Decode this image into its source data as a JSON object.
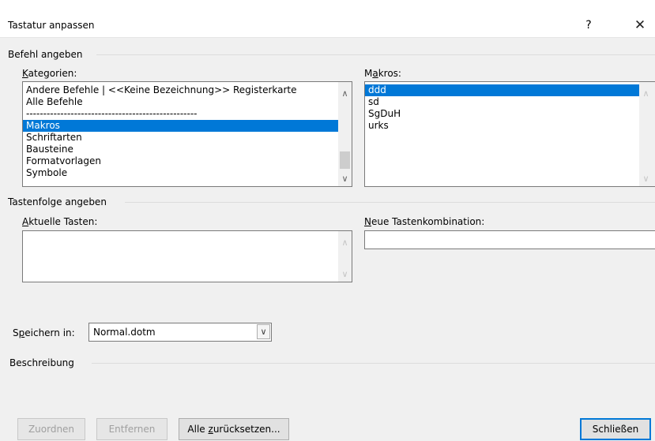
{
  "dialog": {
    "title": "Tastatur anpassen",
    "help_label": "?",
    "close_label": "✕"
  },
  "command_section": {
    "title": "Befehl angeben",
    "categories_label_k": "K",
    "categories_label_rest": "ategorien:",
    "categories": [
      {
        "label": "Andere Befehle | <<Keine Bezeichnung>> Registerkarte",
        "selected": false
      },
      {
        "label": "Alle Befehle",
        "selected": false
      },
      {
        "label": "--------------------------------------------------",
        "selected": false
      },
      {
        "label": "Makros",
        "selected": true
      },
      {
        "label": "Schriftarten",
        "selected": false
      },
      {
        "label": "Bausteine",
        "selected": false
      },
      {
        "label": "Formatvorlagen",
        "selected": false
      },
      {
        "label": "Symbole",
        "selected": false
      }
    ],
    "macros_label_pre": "M",
    "macros_label_a": "a",
    "macros_label_rest": "kros:",
    "macros": [
      {
        "label": "ddd",
        "selected": true
      },
      {
        "label": "sd",
        "selected": false
      },
      {
        "label": "SgDuH",
        "selected": false
      },
      {
        "label": "urks",
        "selected": false
      }
    ]
  },
  "keys_section": {
    "title": "Tastenfolge angeben",
    "current_keys_label_a": "A",
    "current_keys_label_rest": "ktuelle Tasten:",
    "new_combo_label_n": "N",
    "new_combo_label_rest": "eue Tastenkombination:",
    "new_combo_value": ""
  },
  "save_in": {
    "label_s": "S",
    "label_p": "p",
    "label_rest": "eichern in:",
    "value": "Normal.dotm"
  },
  "description": {
    "title": "Beschreibung"
  },
  "buttons": {
    "assign": "Zuordnen",
    "remove": "Entfernen",
    "reset_all_pre": "Alle ",
    "reset_all_u": "z",
    "reset_all_rest": "urücksetzen...",
    "close": "Schließen"
  },
  "icons": {
    "scroll_up": "∧",
    "scroll_down": "∨",
    "combo_dropdown": "∨"
  }
}
